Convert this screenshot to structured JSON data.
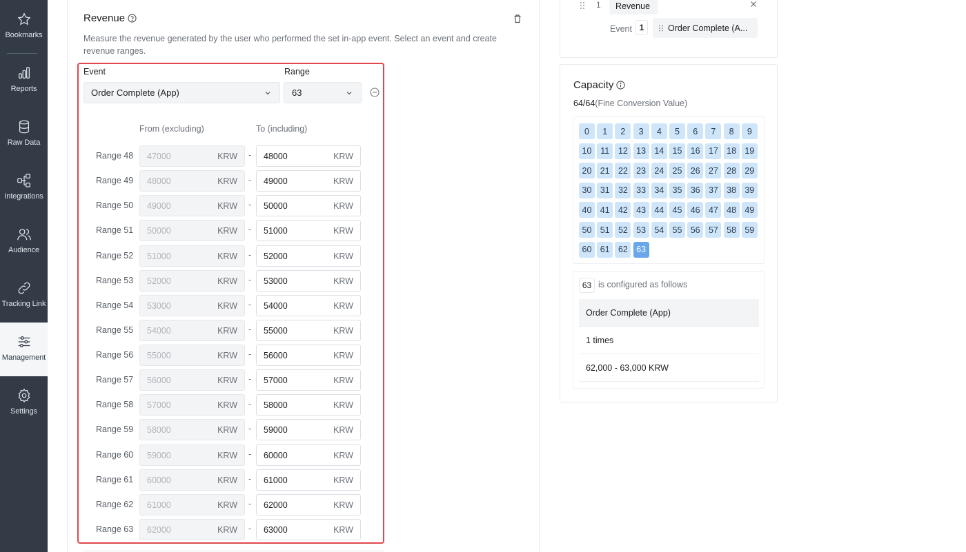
{
  "sidebar": {
    "items": [
      {
        "label": "Bookmarks",
        "icon": "star-icon"
      },
      {
        "label": "Reports",
        "icon": "bar-chart-icon"
      },
      {
        "label": "Raw Data",
        "icon": "database-icon"
      },
      {
        "label": "Integrations",
        "icon": "integrations-icon"
      },
      {
        "label": "Audience",
        "icon": "users-icon"
      },
      {
        "label": "Tracking Link",
        "icon": "link-icon"
      },
      {
        "label": "Management",
        "icon": "sliders-icon",
        "active": true
      },
      {
        "label": "Settings",
        "icon": "gear-icon"
      }
    ]
  },
  "revenue": {
    "title": "Revenue",
    "description": "Measure the revenue generated by the user who performed the set in-app event. Select an event and create revenue ranges.",
    "event_label": "Event",
    "event_value": "Order Complete (App)",
    "range_label": "Range",
    "range_value": "63",
    "col_from": "From (excluding)",
    "col_to": "To (including)",
    "currency": "KRW",
    "rows": [
      {
        "label": "Range 48",
        "from": "47000",
        "to": "48000"
      },
      {
        "label": "Range 49",
        "from": "48000",
        "to": "49000"
      },
      {
        "label": "Range 50",
        "from": "49000",
        "to": "50000"
      },
      {
        "label": "Range 51",
        "from": "50000",
        "to": "51000"
      },
      {
        "label": "Range 52",
        "from": "51000",
        "to": "52000"
      },
      {
        "label": "Range 53",
        "from": "52000",
        "to": "53000"
      },
      {
        "label": "Range 54",
        "from": "53000",
        "to": "54000"
      },
      {
        "label": "Range 55",
        "from": "54000",
        "to": "55000"
      },
      {
        "label": "Range 56",
        "from": "55000",
        "to": "56000"
      },
      {
        "label": "Range 57",
        "from": "56000",
        "to": "57000"
      },
      {
        "label": "Range 58",
        "from": "57000",
        "to": "58000"
      },
      {
        "label": "Range 59",
        "from": "58000",
        "to": "59000"
      },
      {
        "label": "Range 60",
        "from": "59000",
        "to": "60000"
      },
      {
        "label": "Range 61",
        "from": "60000",
        "to": "61000"
      },
      {
        "label": "Range 62",
        "from": "61000",
        "to": "62000"
      },
      {
        "label": "Range 63",
        "from": "62000",
        "to": "63000"
      }
    ]
  },
  "sequence": {
    "number": "1",
    "chip": "Revenue",
    "event_label": "Event",
    "event_number": "1",
    "event_chip": "Order Complete (A..."
  },
  "capacity": {
    "title": "Capacity",
    "count": "64/64",
    "count_sub": "(Fine Conversion Value)",
    "cells": [
      "0",
      "1",
      "2",
      "3",
      "4",
      "5",
      "6",
      "7",
      "8",
      "9",
      "10",
      "11",
      "12",
      "13",
      "14",
      "15",
      "16",
      "17",
      "18",
      "19",
      "20",
      "21",
      "22",
      "23",
      "24",
      "25",
      "26",
      "27",
      "28",
      "29",
      "30",
      "31",
      "32",
      "33",
      "34",
      "35",
      "36",
      "37",
      "38",
      "39",
      "40",
      "41",
      "42",
      "43",
      "44",
      "45",
      "46",
      "47",
      "48",
      "49",
      "50",
      "51",
      "52",
      "53",
      "54",
      "55",
      "56",
      "57",
      "58",
      "59",
      "60",
      "61",
      "62",
      "63"
    ],
    "selected": "63",
    "config_text": "is configured as follows",
    "config_rows": [
      "Order Complete (App)",
      "1 times",
      "62,000 - 63,000 KRW"
    ]
  },
  "colors": {
    "sidebar_bg": "#323b46",
    "highlight_border": "#e0474c",
    "cell_bg": "#cfe6fa",
    "cell_selected": "#6aa7ea"
  }
}
